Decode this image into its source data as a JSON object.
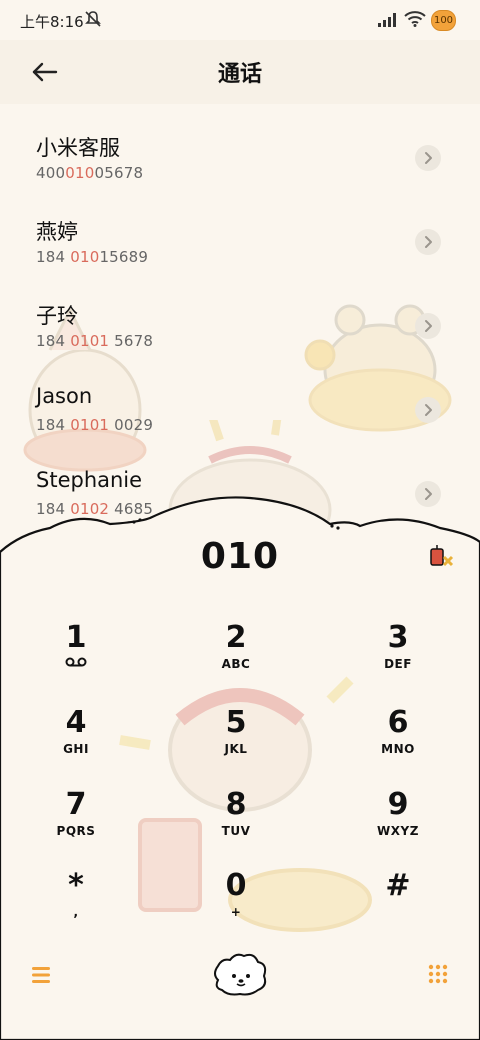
{
  "status_bar": {
    "time": "上午8:16",
    "battery": "100",
    "icons": [
      "mute-icon",
      "signal-icon",
      "wifi-icon",
      "battery-icon"
    ]
  },
  "header": {
    "title": "通话",
    "back_icon": "back-arrow-icon"
  },
  "contacts": [
    {
      "name": "小米客服",
      "number_pre": "400",
      "number_hl": "010",
      "number_post": "05678"
    },
    {
      "name": "燕婷",
      "number_pre": "184 ",
      "number_hl": "010",
      "number_post": "15689"
    },
    {
      "name": "子玲",
      "number_pre": "184 ",
      "number_hl": "0101",
      "number_post": " 5678"
    },
    {
      "name": "Jason",
      "number_pre": "184 ",
      "number_hl": "0101",
      "number_post": " 0029"
    },
    {
      "name": "Stephanie",
      "number_pre": "184 ",
      "number_hl": "0102",
      "number_post": " 4685"
    }
  ],
  "dialer": {
    "entered_number": "010",
    "keys": [
      {
        "digit": "1",
        "letters": ""
      },
      {
        "digit": "2",
        "letters": "ABC"
      },
      {
        "digit": "3",
        "letters": "DEF"
      },
      {
        "digit": "4",
        "letters": "GHI"
      },
      {
        "digit": "5",
        "letters": "JKL"
      },
      {
        "digit": "6",
        "letters": "MNO"
      },
      {
        "digit": "7",
        "letters": "PQRS"
      },
      {
        "digit": "8",
        "letters": "TUV"
      },
      {
        "digit": "9",
        "letters": "WXYZ"
      },
      {
        "digit": "*",
        "letters": ","
      },
      {
        "digit": "0",
        "letters": "+"
      },
      {
        "digit": "#",
        "letters": ""
      }
    ]
  },
  "bottom_bar": {
    "menu_icon": "menu-icon",
    "call_icon": "call-dog-icon",
    "keypad_icon": "keypad-grid-icon"
  },
  "colors": {
    "background": "#fbf6ee",
    "header": "#f7f1e7",
    "highlight": "#d96b5c",
    "accent": "#f2a23a"
  }
}
